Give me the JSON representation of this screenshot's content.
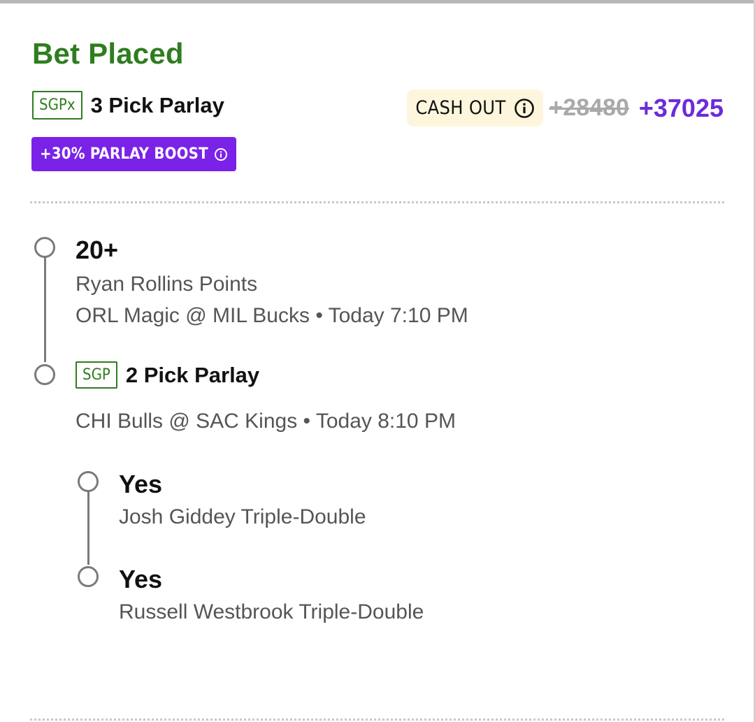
{
  "bet": {
    "status": "Bet Placed",
    "tag": "SGPx",
    "title": "3 Pick Parlay",
    "cashout_label": "CASH OUT",
    "old_odds": "+28480",
    "new_odds": "+37025",
    "boost_label": "+30% PARLAY BOOST"
  },
  "legs": [
    {
      "selection": "20+",
      "market": "Ryan Rollins Points",
      "event": "ORL Magic @ MIL Bucks • Today 7:10 PM"
    },
    {
      "tag": "SGP",
      "title": "2 Pick Parlay",
      "event": "CHI Bulls @ SAC Kings • Today 8:10 PM",
      "sub_legs": [
        {
          "selection": "Yes",
          "market": "Josh Giddey Triple-Double"
        },
        {
          "selection": "Yes",
          "market": "Russell Westbrook Triple-Double"
        }
      ]
    }
  ],
  "colors": {
    "status_green": "#2e7d1f",
    "boost_purple": "#7b22e8",
    "odds_purple": "#6c2bd9",
    "cashout_bg": "#fdf6dd"
  }
}
